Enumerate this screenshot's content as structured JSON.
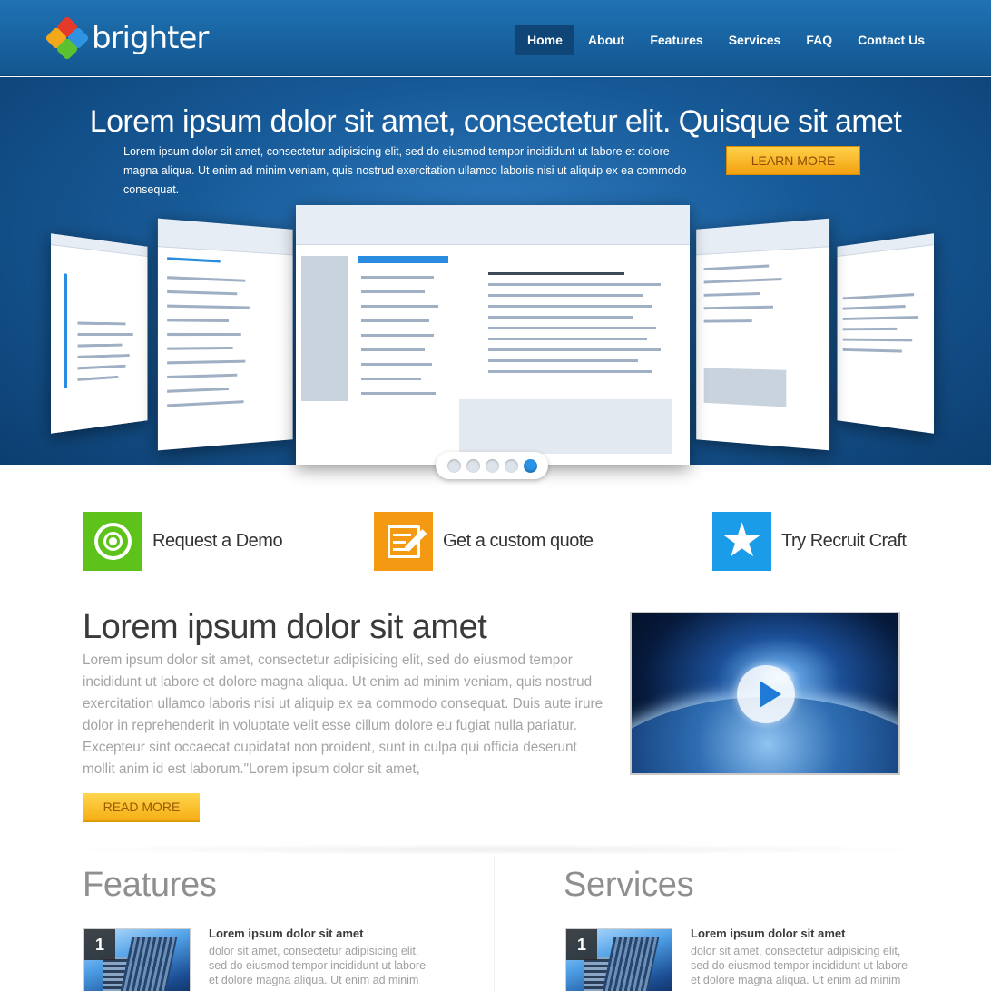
{
  "logo": {
    "text": "brighter"
  },
  "nav": {
    "items": [
      {
        "label": "Home",
        "active": true
      },
      {
        "label": "About"
      },
      {
        "label": "Features"
      },
      {
        "label": "Services"
      },
      {
        "label": "FAQ"
      },
      {
        "label": "Contact Us"
      }
    ]
  },
  "hero": {
    "title": "Lorem ipsum dolor sit amet, consectetur elit. Quisque sit amet",
    "text": "Lorem ipsum dolor sit amet, consectetur adipisicing elit, sed do eiusmod tempor incididunt ut labore et dolore magna aliqua. Ut enim ad minim veniam, quis nostrud exercitation ullamco laboris nisi ut aliquip ex ea commodo consequat.",
    "button_label": "Learn More",
    "slider": {
      "count": 5,
      "active_index": 4
    }
  },
  "ctas": [
    {
      "label": "Request a Demo",
      "icon": "target-icon",
      "color": "#5dc31b"
    },
    {
      "label": "Get a custom quote",
      "icon": "edit-icon",
      "color": "#f39a12"
    },
    {
      "label": "Try Recruit Craft",
      "icon": "star-icon",
      "color": "#1a9ce8"
    }
  ],
  "intro": {
    "title": "Lorem ipsum dolor sit amet",
    "text": "Lorem ipsum dolor sit amet, consectetur adipisicing elit, sed do eiusmod tempor incididunt ut labore et dolore magna aliqua. Ut enim ad minim veniam, quis nostrud exercitation ullamco laboris nisi ut aliquip ex ea commodo consequat. Duis aute irure dolor in reprehenderit in voluptate velit esse cillum dolore eu fugiat nulla pariatur. Excepteur sint occaecat cupidatat non proident, sunt in culpa qui officia deserunt mollit anim id est laborum.\"Lorem ipsum dolor sit amet,",
    "button_label": "Read More",
    "video_icon": "play-icon"
  },
  "features": {
    "title": "Features",
    "item": {
      "number": "1",
      "title": "Lorem ipsum dolor sit amet",
      "text": "dolor sit amet, consectetur adipisicing elit, sed do eiusmod tempor incididunt ut labore et dolore magna aliqua. Ut enim ad minim"
    }
  },
  "services": {
    "title": "Services",
    "item": {
      "number": "1",
      "title": "Lorem ipsum dolor sit amet",
      "text": "dolor sit amet, consectetur adipisicing elit, sed do eiusmod tempor incididunt ut labore et dolore magna aliqua. Ut enim ad minim"
    }
  },
  "colors": {
    "brand_blue": "#1a63a4",
    "accent_orange": "#f6ae16",
    "nav_active": "#0f4677"
  }
}
